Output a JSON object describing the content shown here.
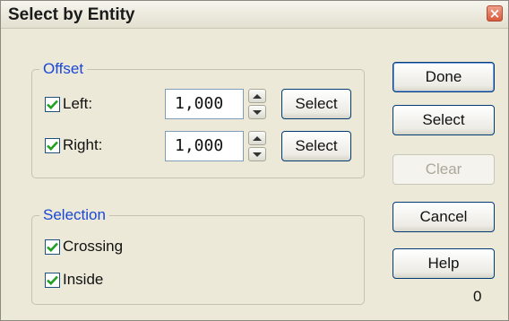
{
  "window": {
    "title": "Select by Entity",
    "close_glyph": "×"
  },
  "offset_group": {
    "legend": "Offset",
    "left": {
      "label": "Left:",
      "checked": true,
      "value": "1,000",
      "select_label": "Select"
    },
    "right": {
      "label": "Right:",
      "checked": true,
      "value": "1,000",
      "select_label": "Select"
    }
  },
  "selection_group": {
    "legend": "Selection",
    "crossing": {
      "label": "Crossing",
      "checked": true
    },
    "inside": {
      "label": "Inside",
      "checked": true
    }
  },
  "buttons": {
    "done": "Done",
    "select": "Select",
    "clear": "Clear",
    "cancel": "Cancel",
    "help": "Help"
  },
  "count": "0",
  "colors": {
    "legend": "#1a47d6",
    "checkmark": "#21a121",
    "close": "#d65a3c"
  }
}
